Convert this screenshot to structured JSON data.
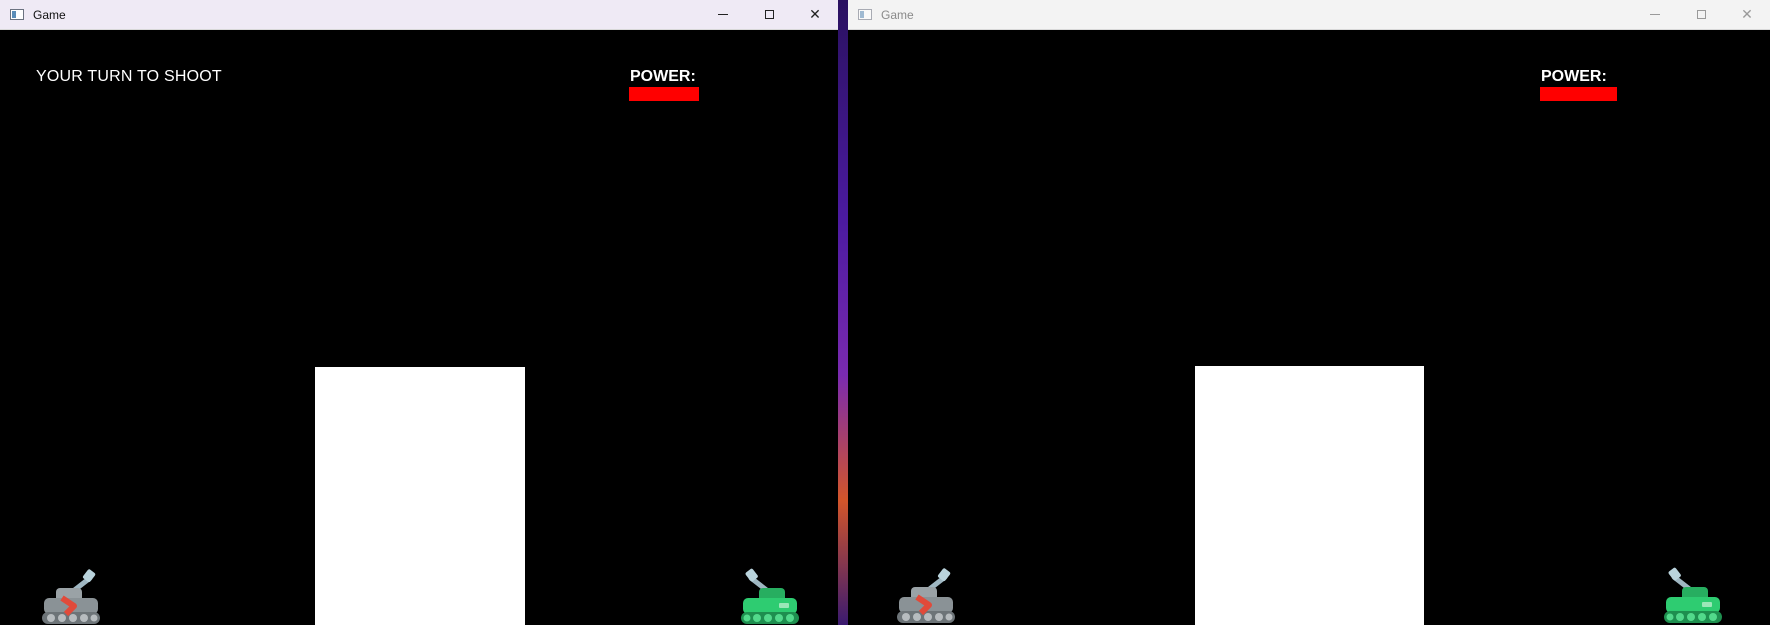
{
  "windows": [
    {
      "title": "Game",
      "hud": {
        "status": "YOUR TURN TO SHOOT",
        "power_label": "POWER:",
        "power_level": 1.0
      }
    },
    {
      "title": "Game",
      "hud": {
        "status": "",
        "power_label": "POWER:",
        "power_level": 1.0
      }
    }
  ],
  "colors": {
    "background": "#000000",
    "power_bar": "#ff0000",
    "wall": "#ffffff",
    "player_tank": "#8a9296",
    "player_accent": "#e14a3a",
    "enemy_tank": "#2ecc71"
  },
  "icons": [
    "app-icon",
    "minimize-icon",
    "maximize-icon",
    "close-icon",
    "gray-tank-icon",
    "green-tank-icon"
  ]
}
